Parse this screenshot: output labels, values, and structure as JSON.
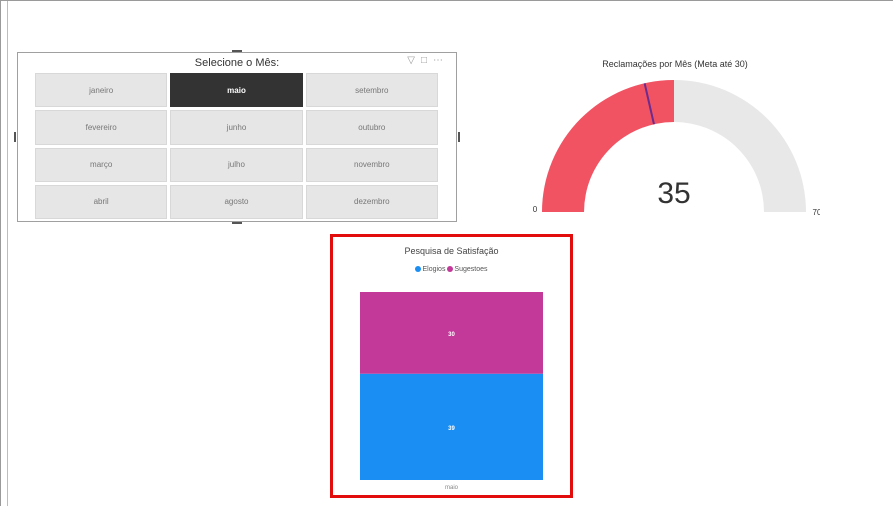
{
  "slicer": {
    "title": "Selecione o Mês:",
    "months": [
      {
        "label": "janeiro",
        "selected": false
      },
      {
        "label": "maio",
        "selected": true
      },
      {
        "label": "setembro",
        "selected": false
      },
      {
        "label": "fevereiro",
        "selected": false
      },
      {
        "label": "junho",
        "selected": false
      },
      {
        "label": "outubro",
        "selected": false
      },
      {
        "label": "março",
        "selected": false
      },
      {
        "label": "julho",
        "selected": false
      },
      {
        "label": "novembro",
        "selected": false
      },
      {
        "label": "abril",
        "selected": false
      },
      {
        "label": "agosto",
        "selected": false
      },
      {
        "label": "dezembro",
        "selected": false
      }
    ],
    "icons": [
      "filter-icon",
      "focus-mode-icon",
      "more-options-icon"
    ]
  },
  "gauge": {
    "title": "Reclamações por Mês (Meta até 30)",
    "value": 35,
    "min": 0,
    "max": 70,
    "target": 30,
    "value_label": "35",
    "min_label": "0",
    "max_label": "70",
    "target_label": "30",
    "fill_color": "#f15363",
    "track_color": "#e8e8e8",
    "target_color": "#6b2b8f"
  },
  "satisfaction": {
    "title": "Pesquisa de Satisfação",
    "legend": [
      {
        "label": "Elogios",
        "color": "#1a8ef2"
      },
      {
        "label": "Sugestoes",
        "color": "#c2399a"
      }
    ]
  },
  "chart_data": {
    "type": "bar",
    "stacked": true,
    "title": "Pesquisa de Satisfação",
    "categories": [
      "maio"
    ],
    "series": [
      {
        "name": "Elogios",
        "values": [
          39
        ],
        "color": "#1a8ef2"
      },
      {
        "name": "Sugestoes",
        "values": [
          30
        ],
        "color": "#c2399a"
      }
    ],
    "legend_position": "top-center",
    "grid": false
  }
}
